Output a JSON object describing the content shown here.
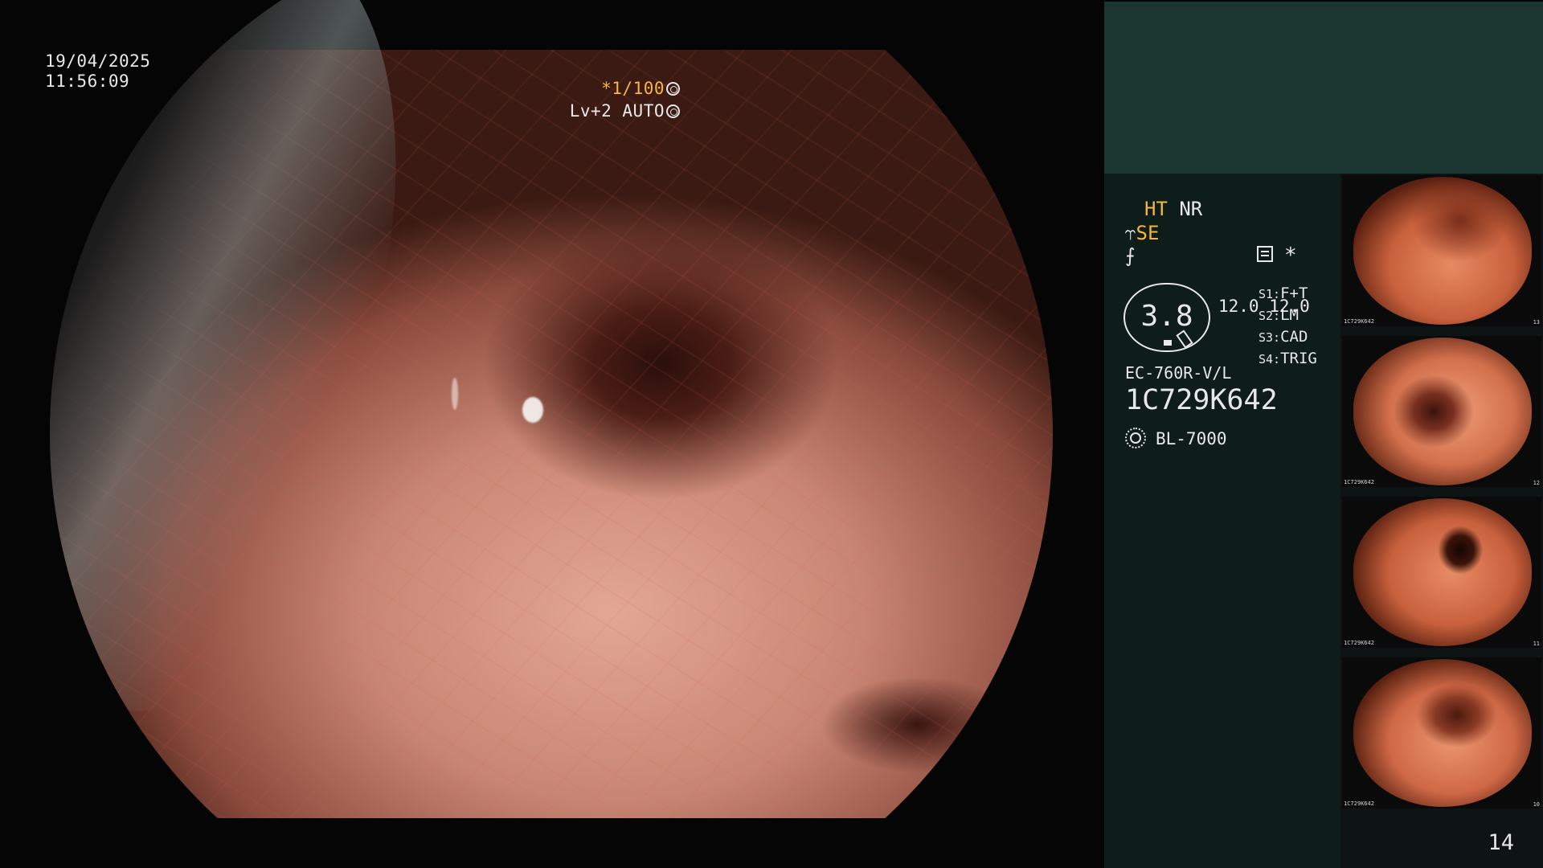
{
  "overlay": {
    "date": "19/04/2025",
    "time": "11:56:09",
    "shutter": "*1/100",
    "level": "Lv+2 AUTO"
  },
  "panel": {
    "mode_ht": "HT",
    "mode_nr": "NR",
    "se": "SE",
    "gauge_value": "3.8",
    "values": [
      "12.0",
      "12.0"
    ],
    "scope_settings": [
      {
        "key": "S1:",
        "value": "F+T"
      },
      {
        "key": "S2:",
        "value": "LM"
      },
      {
        "key": "S3:",
        "value": "CAD"
      },
      {
        "key": "S4:",
        "value": "TRIG"
      }
    ],
    "scope_model": "EC-760R-V/L",
    "serial": "1C729K642",
    "light_source": "BL-7000",
    "page_number": "14"
  },
  "thumbnails": [
    {
      "serial": "1C729K642",
      "number": "13"
    },
    {
      "serial": "1C729K642",
      "number": "12"
    },
    {
      "serial": "1C729K642",
      "number": "11"
    },
    {
      "serial": "1C729K642",
      "number": "10"
    }
  ],
  "colors": {
    "accent_yellow": "#f4b63c",
    "panel_teal": "#1b3530",
    "panel_dark": "#0f1d1a"
  }
}
